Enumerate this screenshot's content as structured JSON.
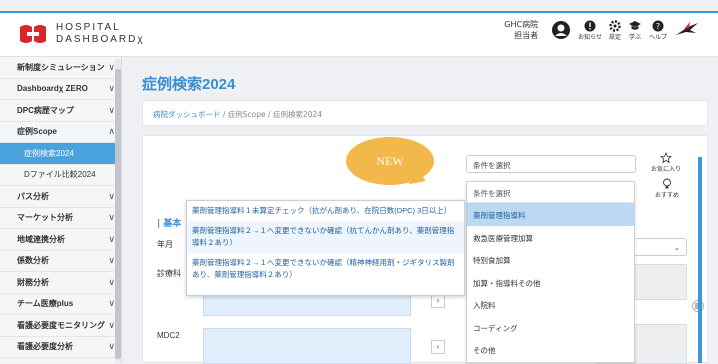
{
  "header": {
    "logo_line1": "HOSPITAL",
    "logo_line2": "DASHBOARDχ",
    "user_line1": "GHC病院",
    "user_line2": "担当者",
    "icons": [
      {
        "name": "bell-icon",
        "label": "お知らせ"
      },
      {
        "name": "gear-icon",
        "label": "設定"
      },
      {
        "name": "graduation-cap-icon",
        "label": "学ぶ"
      },
      {
        "name": "help-icon",
        "label": "ヘルプ"
      }
    ]
  },
  "sidebar": {
    "items": [
      {
        "label": "新制度シミュレーション",
        "chevron": "∨"
      },
      {
        "label": "Dashboardχ ZERO",
        "chevron": "∨"
      },
      {
        "label": "DPC病歴マップ",
        "chevron": "∨"
      },
      {
        "label": "症例Scope",
        "chevron": "∧"
      },
      {
        "label": "症例検索2024",
        "sub": true,
        "active": true
      },
      {
        "label": "Dファイル比較2024",
        "sub": true
      },
      {
        "label": "パス分析",
        "chevron": "∨"
      },
      {
        "label": "マーケット分析",
        "chevron": "∨"
      },
      {
        "label": "地域連携分析",
        "chevron": "∨"
      },
      {
        "label": "係数分析",
        "chevron": "∨"
      },
      {
        "label": "財務分析",
        "chevron": "∨"
      },
      {
        "label": "チーム医療plus",
        "chevron": "∨"
      },
      {
        "label": "看護必要度モニタリング",
        "chevron": "∨"
      },
      {
        "label": "看護必要度分析",
        "chevron": "∨"
      }
    ]
  },
  "main": {
    "title": "症例検索2024",
    "breadcrumb": {
      "home": "病院ダッシュボード",
      "sep1": " / ",
      "mid": "症例Scope",
      "sep2": " / ",
      "current": "症例検索2024"
    },
    "section_title": "| 基本",
    "label_month": "年月",
    "label_fee": "診療科",
    "label_mdc": "MDC2",
    "condition_select": "条件を選択",
    "favorite_label": "お気に入り",
    "recommend_label": "おすすめ"
  },
  "callout": {
    "text": "NEW"
  },
  "dropdown": {
    "header": "条件を選択",
    "items": [
      "薬剤管理指導料",
      "救急医療管理加算",
      "特別食加算",
      "加算・指導料その他",
      "入院料",
      "コーディング",
      "その他"
    ],
    "selected": "薬剤管理指導料"
  },
  "tooltip": {
    "items": [
      "薬剤管理指導料１未算定チェック（抗がん剤あり、在院日数(DPC) 3日以上）",
      "薬剤管理指導料２→１へ変更できないか確認（抗てんかん剤あり、薬剤管理指導料２あり）",
      "薬剤管理指導料２→１へ変更できないか確認（精神神経用剤・ジギタリス製剤あり、薬剤管理指導料２あり）"
    ]
  },
  "colors": {
    "accent": "#3a8fd0",
    "active": "#4aa2dd",
    "callout": "#f2b84a",
    "selected": "#bcd9f3"
  }
}
